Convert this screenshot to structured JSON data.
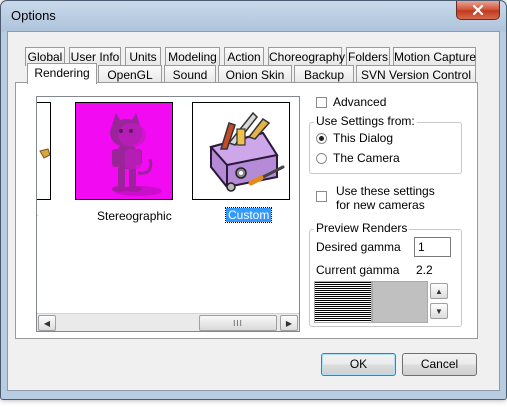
{
  "window": {
    "title": "Options"
  },
  "tabs_row1": [
    "Global",
    "User Info",
    "Units",
    "Modeling",
    "Action",
    "Choreography",
    "Folders",
    "Motion Capture"
  ],
  "tabs_row2": [
    "Rendering",
    "OpenGL",
    "Sound",
    "Onion Skin",
    "Backup",
    "SVN Version Control"
  ],
  "active_tab": "Rendering",
  "presets": [
    {
      "label": "Stereographic",
      "selected": false
    },
    {
      "label": "Custom",
      "selected": true
    }
  ],
  "scrollbar": {
    "grip": "III"
  },
  "advanced": {
    "label": "Advanced",
    "checked": false
  },
  "use_settings": {
    "title": "Use Settings from:",
    "options": [
      {
        "label": "This Dialog",
        "selected": true
      },
      {
        "label": "The Camera",
        "selected": false
      }
    ]
  },
  "new_cameras": {
    "label_line1": "Use these settings",
    "label_line2": "for new cameras",
    "checked": false
  },
  "preview": {
    "title": "Preview Renders",
    "desired_gamma_label": "Desired gamma",
    "desired_gamma_value": "1",
    "current_gamma_label": "Current gamma",
    "current_gamma_value": "2.2"
  },
  "buttons": {
    "ok": "OK",
    "cancel": "Cancel"
  },
  "colors": {
    "accent": "#3399ff",
    "selection": "#0a64d8"
  }
}
